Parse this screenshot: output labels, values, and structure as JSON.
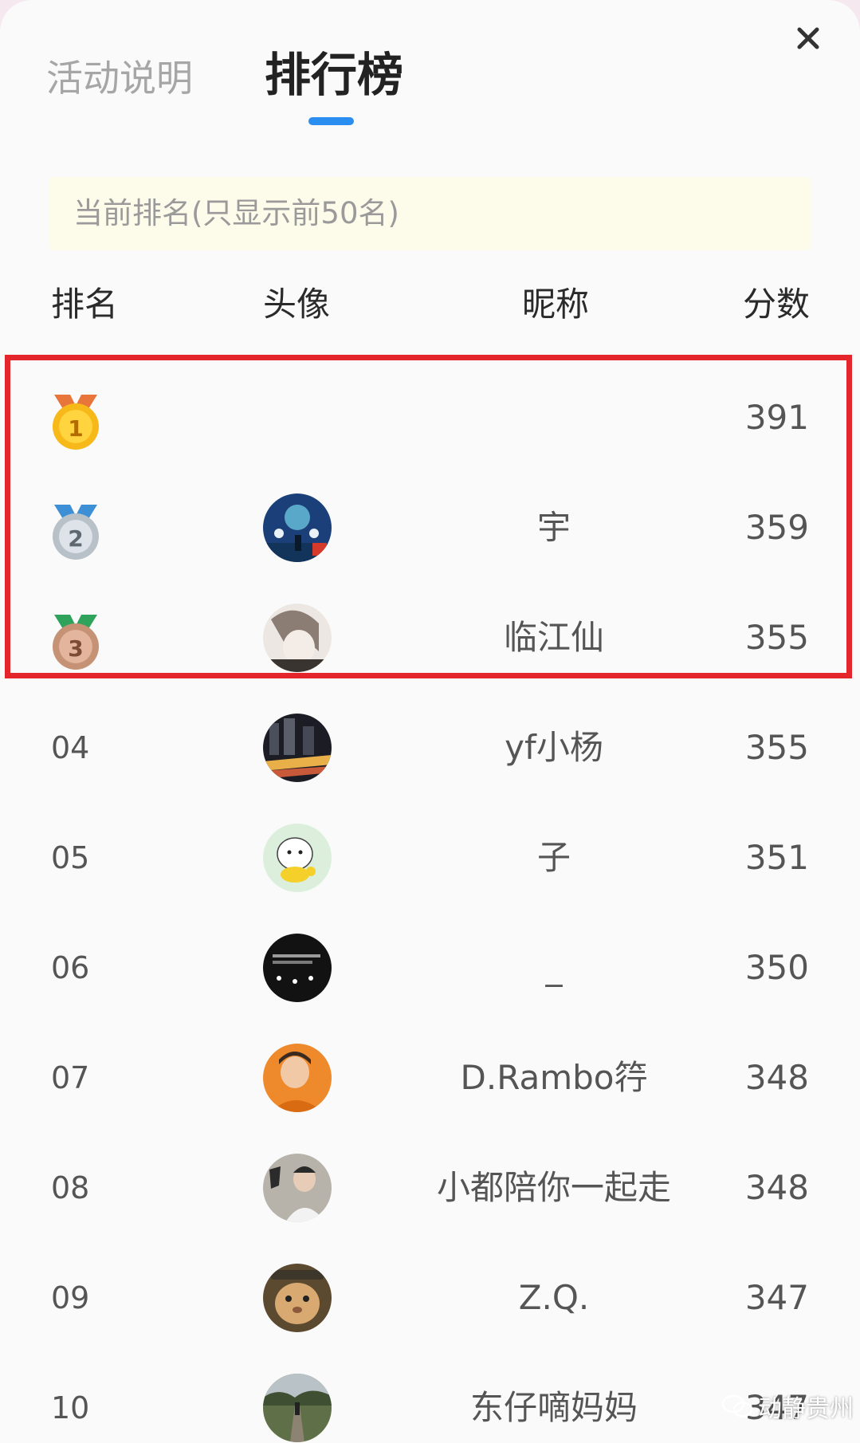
{
  "tabs": {
    "info_label": "活动说明",
    "rank_label": "排行榜",
    "active": "rank"
  },
  "close": {
    "icon": "close-icon",
    "glyph": "✕"
  },
  "notice": "当前排名(只显示前50名)",
  "table": {
    "headers": {
      "rank": "排名",
      "avatar": "头像",
      "nickname": "昵称",
      "score": "分数"
    },
    "rows": [
      {
        "rank": "1",
        "medal": "gold-medal-icon",
        "avatar": null,
        "nickname": "",
        "score": "391"
      },
      {
        "rank": "2",
        "medal": "silver-medal-icon",
        "avatar": "avatar-2",
        "nickname": "宇",
        "score": "359"
      },
      {
        "rank": "3",
        "medal": "bronze-medal-icon",
        "avatar": "avatar-3",
        "nickname": "临江仙",
        "score": "355"
      },
      {
        "rank": "04",
        "medal": null,
        "avatar": "avatar-4",
        "nickname": "yf小杨",
        "score": "355"
      },
      {
        "rank": "05",
        "medal": null,
        "avatar": "avatar-5",
        "nickname": "子",
        "score": "351"
      },
      {
        "rank": "06",
        "medal": null,
        "avatar": "avatar-6",
        "nickname": "_",
        "score": "350"
      },
      {
        "rank": "07",
        "medal": null,
        "avatar": "avatar-7",
        "nickname": "D.Rambo筕",
        "score": "348"
      },
      {
        "rank": "08",
        "medal": null,
        "avatar": "avatar-8",
        "nickname": "小都陪你一起走",
        "score": "348"
      },
      {
        "rank": "09",
        "medal": null,
        "avatar": "avatar-9",
        "nickname": "Z.Q.",
        "score": "347"
      },
      {
        "rank": "10",
        "medal": null,
        "avatar": "avatar-10",
        "nickname": "东仔嘀妈妈",
        "score": "347"
      }
    ]
  },
  "watermark": "动静贵州",
  "colors": {
    "accent": "#2a8ef0",
    "highlight_border": "#e4262c",
    "notice_bg": "#fdfbe9"
  }
}
